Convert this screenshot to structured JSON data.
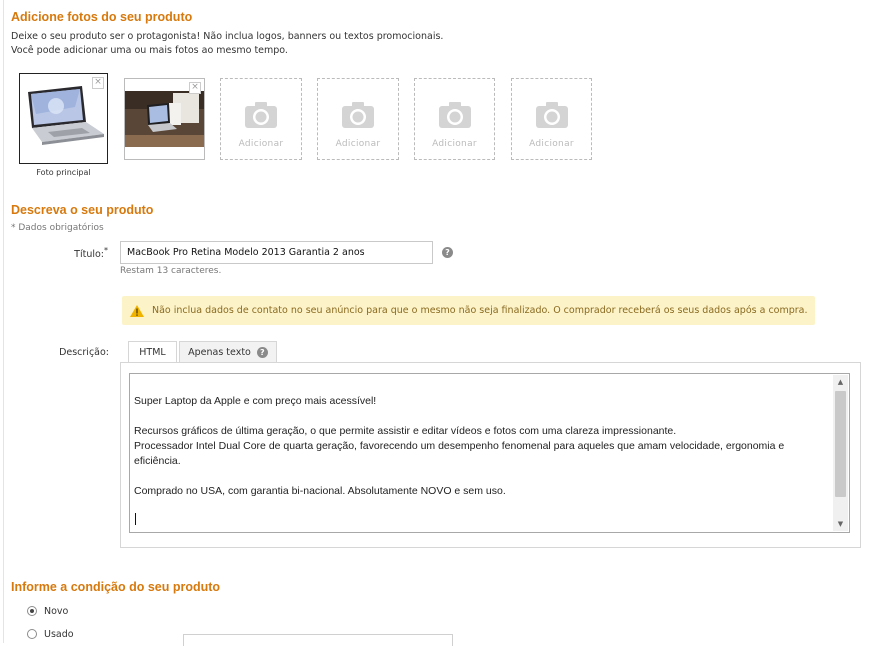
{
  "photos_section": {
    "title": "Adicione fotos do seu produto",
    "description_line1": "Deixe o seu produto ser o protagonista! Não inclua logos, banners ou textos promocionais.",
    "description_line2": "Você pode adicionar uma ou mais fotos ao mesmo tempo.",
    "main_caption": "Foto principal",
    "add_label": "Adicionar",
    "close_symbol": "×",
    "empty_slots": 4
  },
  "describe_section": {
    "title": "Descreva o seu produto",
    "required_note": "* Dados obrigatórios",
    "title_label": "Título:",
    "required_mark": "*",
    "title_value": "MacBook Pro Retina Modelo 2013 Garantia 2 anos",
    "remaining": "Restam 13 caracteres.",
    "help_symbol": "?",
    "warning": "Não inclua dados de contato no seu anúncio para que o mesmo não seja finalizado. O comprador receberá os seus dados após a compra.",
    "description_label": "Descrição:",
    "tabs": [
      "HTML",
      "Apenas texto"
    ],
    "active_tab": "Apenas texto",
    "description_text": "Super Laptop da Apple e com preço mais acessível!\n\nRecursos gráficos de última geração, o que permite assistir e editar vídeos e fotos com uma clareza impressionante.\nProcessador Intel Dual Core de quarta geração, favorecendo um desempenho fenomenal para aqueles que amam velocidade, ergonomia e eficiência.\n\nComprado no USA, com garantia bi-nacional. Absolutamente NOVO e sem uso."
  },
  "condition_section": {
    "title": "Informe a condição do seu produto",
    "options": [
      "Novo",
      "Usado"
    ],
    "selected": "Novo"
  },
  "colors": {
    "accent": "#d7790d",
    "warning_bg": "#fcf3c8",
    "warning_icon": "#f0b400"
  },
  "icons": {
    "camera": "camera-icon",
    "warning": "warning-icon",
    "help": "help-icon"
  }
}
